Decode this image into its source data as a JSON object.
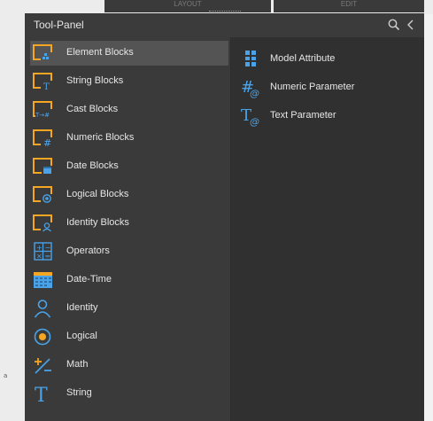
{
  "colors": {
    "accent": "#4aa3e8",
    "orange": "#f5a623",
    "panel_bg": "#3a3a3a",
    "selected_bg": "#545454"
  },
  "top_tabs": {
    "layout": "LAYOUT",
    "edit": "EDIT"
  },
  "background_fragment": "a",
  "panel": {
    "title": "Tool-Panel",
    "search_icon": "search-icon",
    "collapse_icon": "chevron-left-icon"
  },
  "left_items": [
    {
      "label": "Element Blocks",
      "icon": "element-blocks-icon",
      "selected": true
    },
    {
      "label": "String Blocks",
      "icon": "string-blocks-icon"
    },
    {
      "label": "Cast Blocks",
      "icon": "cast-blocks-icon"
    },
    {
      "label": "Numeric Blocks",
      "icon": "numeric-blocks-icon"
    },
    {
      "label": "Date Blocks",
      "icon": "date-blocks-icon"
    },
    {
      "label": "Logical Blocks",
      "icon": "logical-blocks-icon"
    },
    {
      "label": "Identity Blocks",
      "icon": "identity-blocks-icon"
    },
    {
      "label": "Operators",
      "icon": "operators-icon"
    },
    {
      "label": "Date-Time",
      "icon": "calendar-icon"
    },
    {
      "label": "Identity",
      "icon": "person-icon"
    },
    {
      "label": "Logical",
      "icon": "radio-circle-icon"
    },
    {
      "label": "Math",
      "icon": "plus-minus-icon"
    },
    {
      "label": "String",
      "icon": "text-t-icon"
    }
  ],
  "right_items": [
    {
      "label": "Model Attribute",
      "icon": "grid-dots-icon"
    },
    {
      "label": "Numeric Parameter",
      "icon": "hash-at-icon"
    },
    {
      "label": "Text Parameter",
      "icon": "t-at-icon"
    }
  ]
}
